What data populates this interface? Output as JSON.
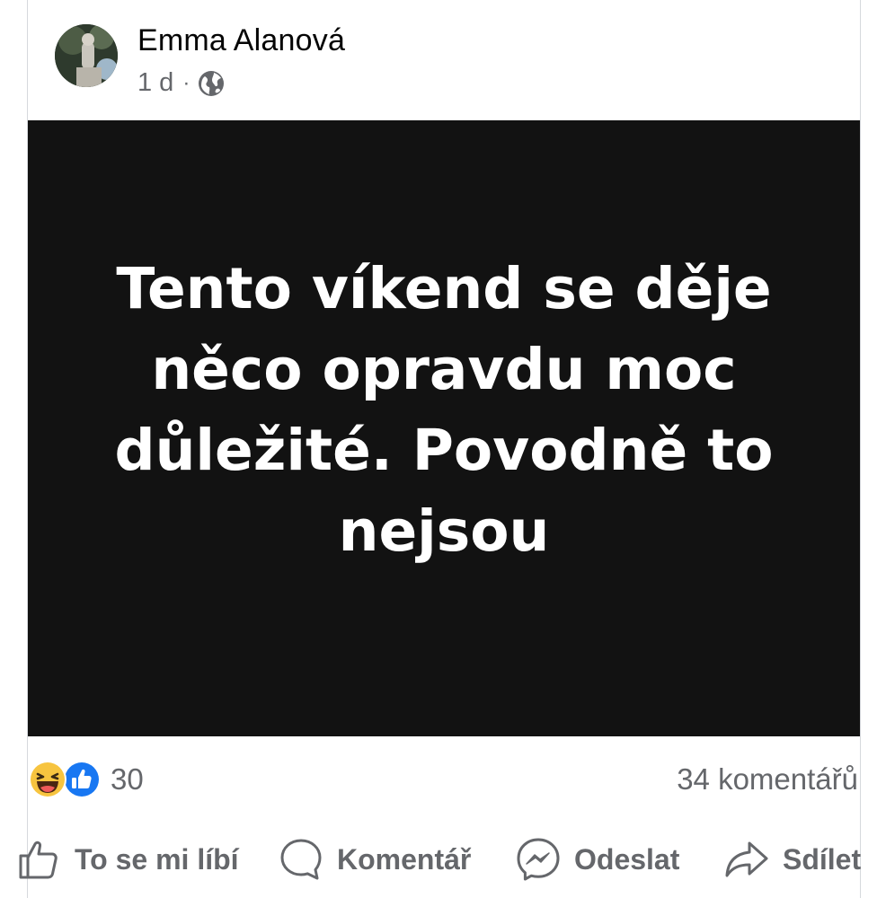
{
  "post": {
    "author": "Emma Alanová",
    "time": "1 d",
    "separator": "·",
    "audience_icon": "globe-icon",
    "image_text": "Tento víkend se děje něco opravdu moc důležité. Povodně to nejsou"
  },
  "stats": {
    "reaction_icons": [
      "haha-icon",
      "like-icon"
    ],
    "reaction_count": "30",
    "comments": "34 komentářů"
  },
  "actions": {
    "like": "To se mi líbí",
    "comment": "Komentář",
    "send": "Odeslat",
    "share": "Sdílet"
  },
  "colors": {
    "image_background": "#121212",
    "image_text": "#ffffff",
    "secondary_text": "#65676b",
    "like_blue": "#1877f2",
    "haha_yellow": "#f7c43f"
  }
}
